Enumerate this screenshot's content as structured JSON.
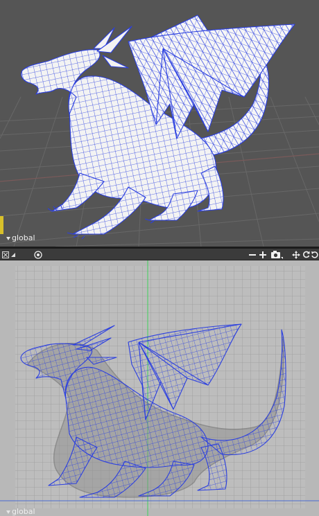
{
  "viewports": {
    "perspective": {
      "mode_label": "global"
    },
    "ortho": {
      "mode_label": "global"
    }
  },
  "toolbar": {
    "icons": [
      "maximize-icon",
      "triangle-icon",
      "target-icon",
      "zoom-out-icon",
      "zoom-in-icon",
      "camera-icon",
      "pan-icon",
      "rotate-icon",
      "reset-icon"
    ]
  },
  "colors": {
    "wire": "#2b3fe0",
    "mesh_fill": "#f2f2f2",
    "perspective_bg": "#555555",
    "ortho_bg": "#bcbcbc",
    "grid_axis_green": "#3fd15a"
  }
}
